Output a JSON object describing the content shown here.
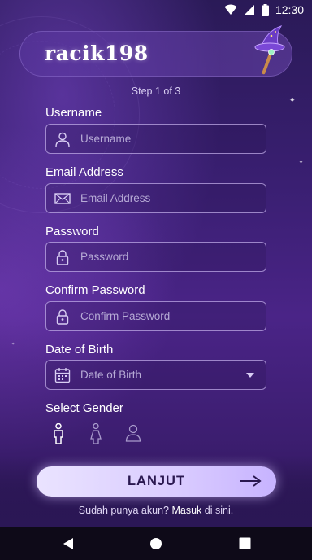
{
  "status_bar": {
    "time": "12:30"
  },
  "header": {
    "brand": "racik198",
    "step": "Step 1 of 3"
  },
  "form": {
    "username": {
      "label": "Username",
      "placeholder": "Username"
    },
    "email": {
      "label": "Email Address",
      "placeholder": "Email Address"
    },
    "password": {
      "label": "Password",
      "placeholder": "Password"
    },
    "confirm_password": {
      "label": "Confirm Password",
      "placeholder": "Confirm Password"
    },
    "dob": {
      "label": "Date of Birth",
      "placeholder": "Date of Birth"
    },
    "gender": {
      "label": "Select Gender"
    }
  },
  "cta": {
    "label": "LANJUT"
  },
  "signin": {
    "prefix": "Sudah punya akun? ",
    "link": "Masuk",
    "suffix": " di sini."
  },
  "icons": {
    "user": "user-icon",
    "mail": "mail-icon",
    "lock": "lock-icon",
    "calendar": "calendar-icon",
    "male": "male-icon",
    "female": "female-icon",
    "neutral": "person-icon",
    "arrow": "arrow-right-icon"
  },
  "colors": {
    "accent": "#d9cbff",
    "background": "#3a1f72",
    "field_border": "#c8b4f0"
  }
}
